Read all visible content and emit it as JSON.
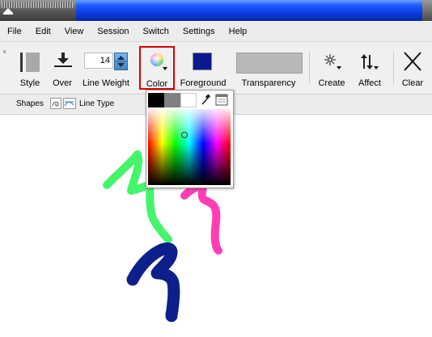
{
  "menubar": {
    "items": [
      "File",
      "Edit",
      "View",
      "Session",
      "Switch",
      "Settings",
      "Help"
    ]
  },
  "toolbar": {
    "close_glyph": "×",
    "style_label": "Style",
    "over_label": "Over",
    "line_weight_label": "Line Weight",
    "line_weight_value": "14",
    "color_label": "Color",
    "foreground_label": "Foreground",
    "transparency_label": "Transparency",
    "create_label": "Create",
    "affect_label": "Affect",
    "clear_label": "Clear",
    "foreground_color": "#0a1a8c",
    "transparency_color": "#b8b8b8",
    "color_button_highlight": "#e00000"
  },
  "shapesbar": {
    "shapes_label": "Shapes",
    "line_type_label": "Line Type"
  },
  "color_popup": {
    "swatches": [
      "#000000",
      "#808080",
      "#ffffff"
    ],
    "icons": [
      "eyedropper-icon",
      "palette-dialog-icon"
    ]
  },
  "canvas": {
    "strokes": [
      {
        "name": "green",
        "color": "#44f56b"
      },
      {
        "name": "pink",
        "color": "#ff3db4"
      },
      {
        "name": "navy",
        "color": "#0d1f8a"
      }
    ]
  }
}
